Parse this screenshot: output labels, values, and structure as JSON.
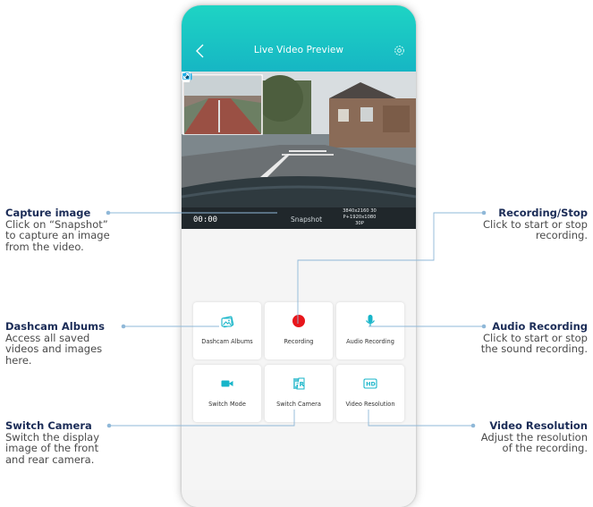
{
  "app": {
    "title": "Live Video Preview",
    "colors": {
      "header": "#1ed4c4",
      "accent": "#17b5c9",
      "record": "#e8161b",
      "annotation_line": "#8fb8d8"
    }
  },
  "video": {
    "time": "00:00",
    "snapshot_label": "Snapshot",
    "resolution_lines": [
      "3840x2160 30",
      "P+1920x1080",
      "30P"
    ]
  },
  "controls": [
    {
      "label": "Dashcam Albums",
      "icon": "album-icon"
    },
    {
      "label": "Recording",
      "icon": "record-dot-icon"
    },
    {
      "label": "Audio Recording",
      "icon": "microphone-icon"
    },
    {
      "label": "Switch Mode",
      "icon": "video-camera-icon"
    },
    {
      "label": "Switch Camera",
      "icon": "front-rear-icon"
    },
    {
      "label": "Video Resolution",
      "icon": "hd-icon"
    }
  ],
  "annotations": {
    "capture": {
      "title": "Capture image",
      "lines": [
        "Click on “Snapshot”",
        "to capture an image",
        "from the video."
      ]
    },
    "albums": {
      "title": "Dashcam Albums",
      "lines": [
        "Access all saved",
        "videos and images",
        "here."
      ]
    },
    "switch_camera": {
      "title": "Switch Camera",
      "lines": [
        "Switch the display",
        "image of the front",
        "and rear camera."
      ]
    },
    "recording": {
      "title": "Recording/Stop",
      "lines": [
        "Click to start or stop",
        "recording."
      ]
    },
    "audio": {
      "title": "Audio Recording",
      "lines": [
        "Click to start or stop",
        "the sound recording."
      ]
    },
    "resolution": {
      "title": "Video Resolution",
      "lines": [
        "Adjust the resolution",
        "of the recording."
      ]
    }
  }
}
